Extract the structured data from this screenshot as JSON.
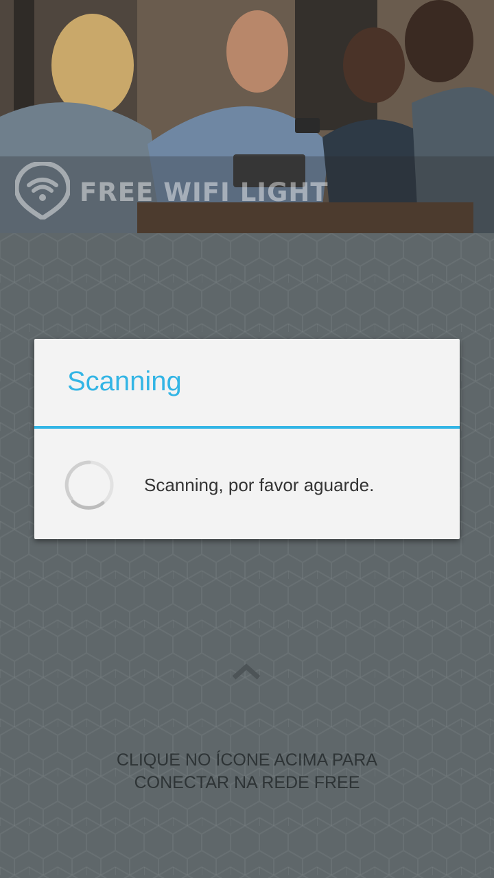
{
  "header": {
    "brand_name": "FREE WIFI LIGHT",
    "logo_icon": "wifi-location-pin-icon"
  },
  "dialog": {
    "title": "Scanning",
    "message": "Scanning, por favor aguarde.",
    "progress_icon": "spinner-icon"
  },
  "main": {
    "arrow_icon": "chevron-up-icon",
    "hint_line1": "CLIQUE NO ÍCONE ACIMA PARA",
    "hint_line2": "CONECTAR NA REDE FREE"
  },
  "colors": {
    "accent": "#33b5e5",
    "background": "#5f676a",
    "dialog_background": "#f3f3f3"
  }
}
